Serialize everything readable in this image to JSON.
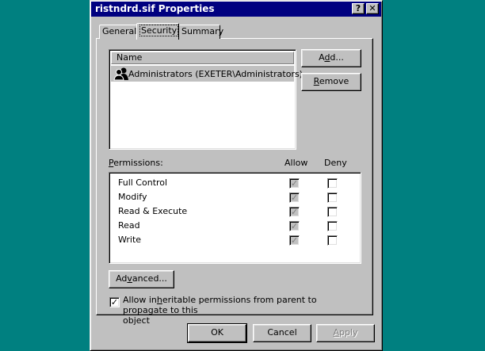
{
  "window": {
    "title": "ristndrd.sif Properties",
    "help_button": "?",
    "close_button": "✕"
  },
  "tabs": [
    {
      "label": "General",
      "active": false
    },
    {
      "label": "Security",
      "active": true
    },
    {
      "label": "Summary",
      "active": false
    }
  ],
  "names_list": {
    "column_header": "Name",
    "items": [
      {
        "label": "Administrators (EXETER\\Administrators)",
        "icon": "group-icon",
        "selected": true
      }
    ]
  },
  "buttons": {
    "add": {
      "pre": "A",
      "u": "d",
      "post": "d..."
    },
    "remove": {
      "pre": "",
      "u": "R",
      "post": "emove"
    },
    "advanced": {
      "pre": "Ad",
      "u": "v",
      "post": "anced..."
    },
    "ok": "OK",
    "cancel": "Cancel",
    "apply": {
      "pre": "",
      "u": "A",
      "post": "pply"
    }
  },
  "permissions": {
    "label": {
      "pre": "",
      "u": "P",
      "post": "ermissions:"
    },
    "allow_header": "Allow",
    "deny_header": "Deny",
    "rows": [
      {
        "name": "Full Control",
        "allow": true,
        "deny": false
      },
      {
        "name": "Modify",
        "allow": true,
        "deny": false
      },
      {
        "name": "Read & Execute",
        "allow": true,
        "deny": false
      },
      {
        "name": "Read",
        "allow": true,
        "deny": false
      },
      {
        "name": "Write",
        "allow": true,
        "deny": false
      }
    ]
  },
  "inherit": {
    "checked": true,
    "line1_pre": "Allow in",
    "line1_u": "h",
    "line1_post": "eritable permissions from parent to propagate to this",
    "line2": "object"
  },
  "colors": {
    "desktop": "#008080",
    "titlebar": "#000080",
    "face": "#c0c0c0"
  }
}
